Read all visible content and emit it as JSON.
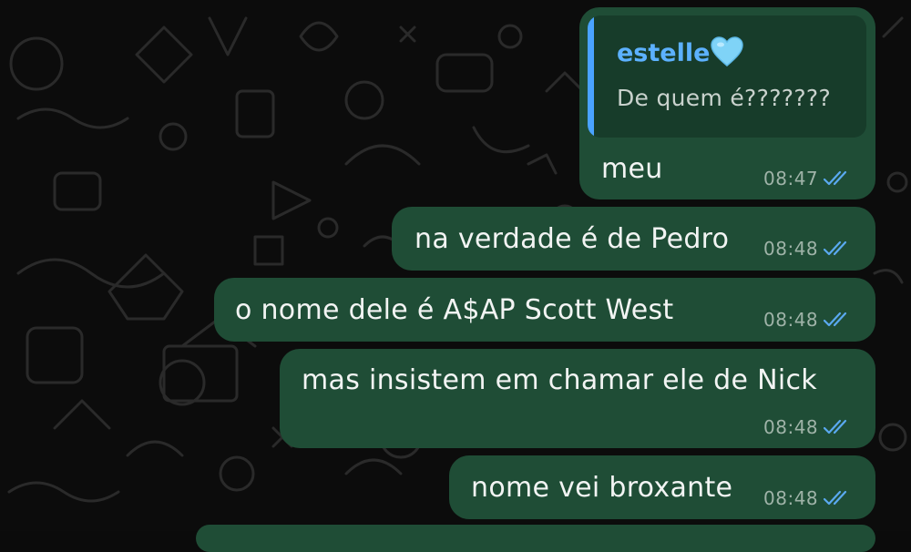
{
  "chat": {
    "reply": {
      "author": "estelle",
      "text": "De quem é???????"
    },
    "messages": [
      {
        "text": "meu",
        "time": "08:47",
        "status": "read"
      },
      {
        "text": "na verdade é de Pedro",
        "time": "08:48",
        "status": "read"
      },
      {
        "text": "o nome dele é A$AP Scott West",
        "time": "08:48",
        "status": "read"
      },
      {
        "text": "mas insistem em chamar ele de Nick",
        "time": "08:48",
        "status": "read"
      },
      {
        "text": "nome vei broxante",
        "time": "08:48",
        "status": "read"
      }
    ]
  },
  "colors": {
    "bubble": "#1f4d36",
    "quote_background": "#173c2a",
    "quote_bar": "#4aa3ff",
    "quote_author": "#5cb1ff",
    "read_ticks": "#5aa9f0",
    "background": "#0c0c0c"
  },
  "icons": {
    "read_receipt": "double-check-icon",
    "author_emoji": "light-blue-heart-icon"
  }
}
